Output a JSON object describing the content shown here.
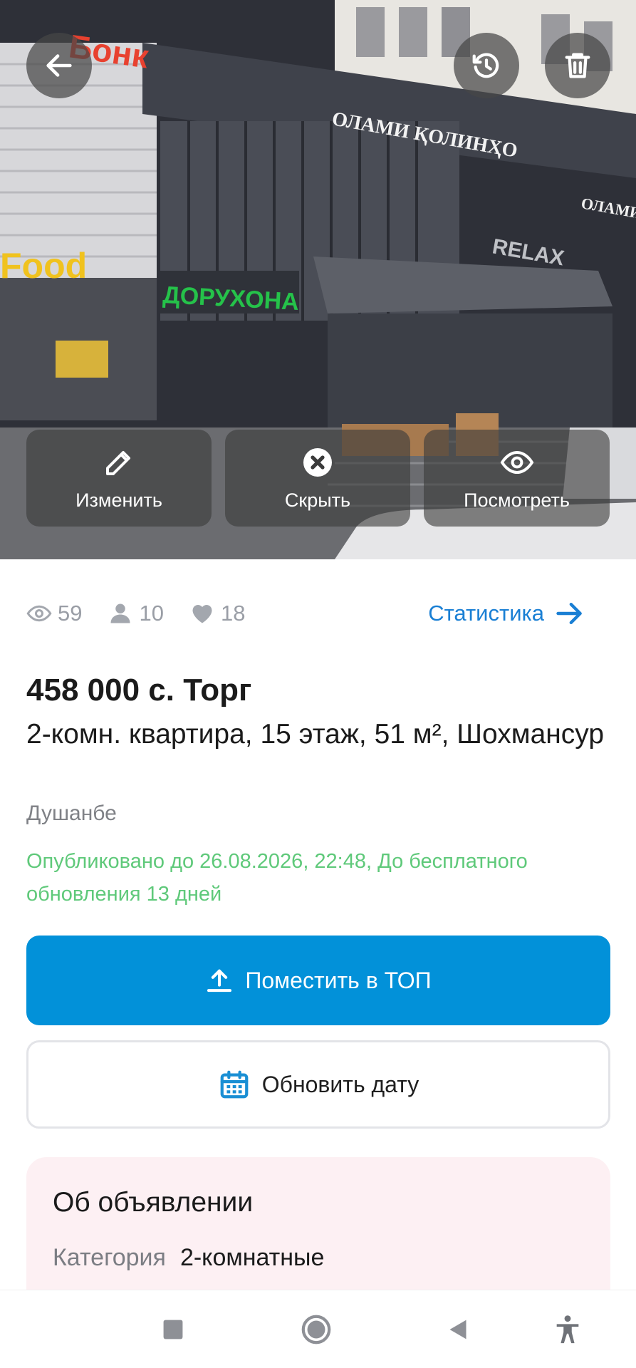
{
  "hero": {
    "signs": {
      "bank": "Бонк",
      "building": "ОЛАМИ ҚОЛИНҲО",
      "building_side": "ОЛАМИ ЗАР",
      "pharmacy": "ДОРУХОНА",
      "food": "Food",
      "relax": "RELAX"
    },
    "top_buttons": {
      "back_icon": "arrow-left-icon",
      "history_icon": "history-icon",
      "delete_icon": "trash-icon"
    },
    "actions": {
      "edit_label": "Изменить",
      "hide_label": "Скрыть",
      "view_label": "Посмотреть"
    }
  },
  "stats": {
    "views": "59",
    "contacts": "10",
    "favorites": "18",
    "link_label": "Статистика"
  },
  "listing": {
    "price": "458 000 с. Торг",
    "title": "2-комн. квартира, 15 этаж, 51 м², Шохмансур",
    "city": "Душанбе",
    "published": "Опубликовано до 26.08.2026, 22:48, До бесплатного обновления 13 дней"
  },
  "buttons": {
    "top_label": "Поместить в ТОП",
    "update_date_label": "Обновить дату"
  },
  "about": {
    "title": "Об объявлении",
    "category_key": "Категория",
    "category_value": "2-комнатные"
  },
  "colors": {
    "accent_blue": "#0291d9",
    "link_blue": "#1a7fd4",
    "published_green": "#5fc97a",
    "about_bg": "#fdf0f3"
  }
}
